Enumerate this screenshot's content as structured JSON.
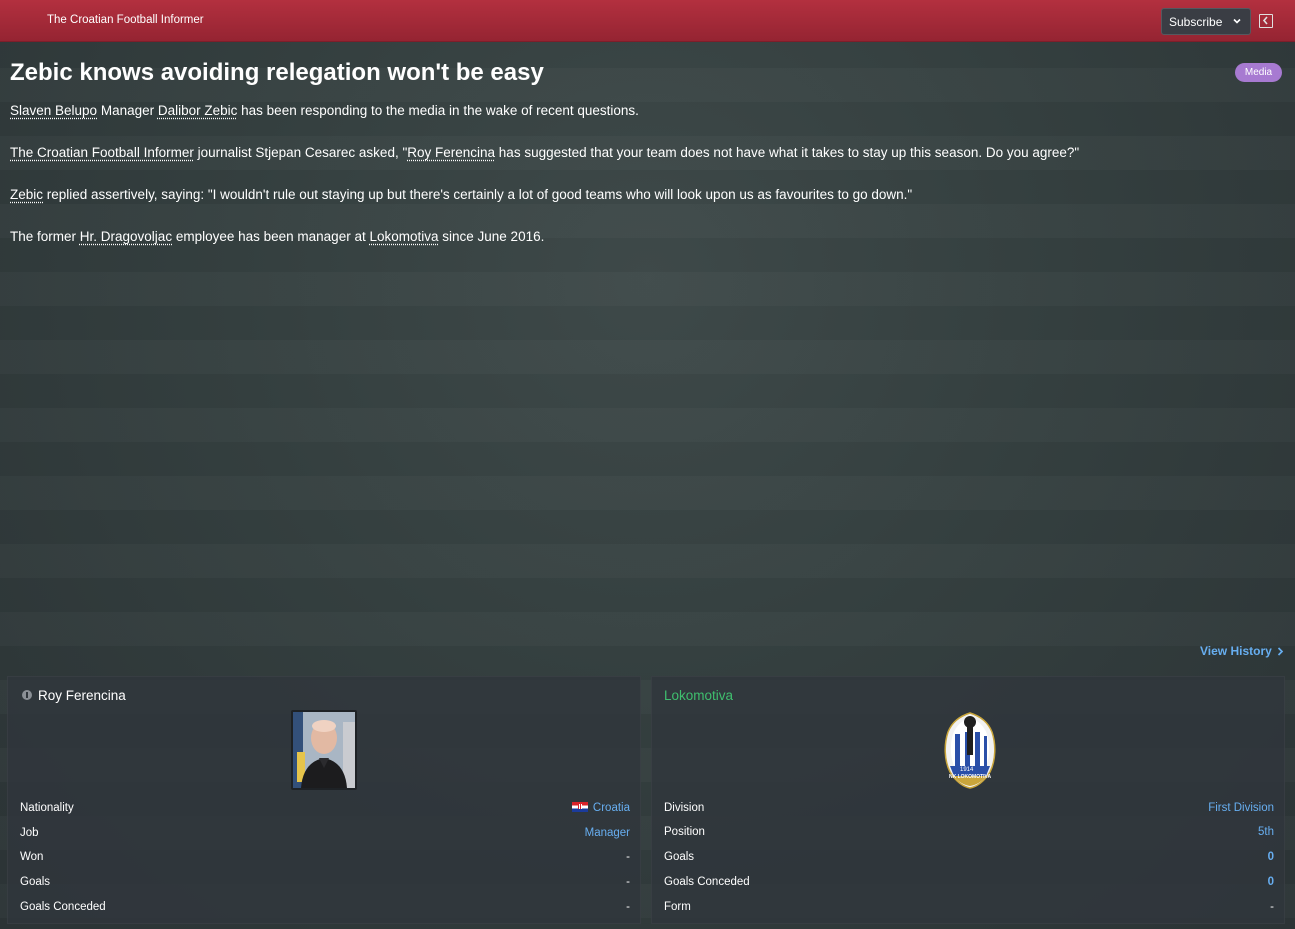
{
  "header": {
    "paper_name": "The Croatian Football Informer",
    "subscribe_label": "Subscribe"
  },
  "article": {
    "headline": "Zebic knows avoiding relegation won't be easy",
    "badge": "Media",
    "p1": {
      "club": "Slaven Belupo",
      "t1": " Manager ",
      "manager": "Dalibor Zebic",
      "t2": " has been responding to the media in the wake of recent questions."
    },
    "p2": {
      "paper": "The Croatian Football Informer",
      "t1": " journalist Stjepan Cesarec asked, \"",
      "person": "Roy Ferencina",
      "t2": " has suggested that your team does not have what it takes to stay up this season. Do you agree?\""
    },
    "p3": {
      "manager": "Zebic",
      "t1": " replied assertively, saying: \"I wouldn't rule out staying up but there's certainly a lot of good teams who will look upon us as favourites to go down.\""
    },
    "p4": {
      "t1": "The former ",
      "club": "Hr. Dragovoljac",
      "t2": " employee has been manager at ",
      "club2": "Lokomotiva",
      "t3": " since June 2016."
    }
  },
  "view_history_label": "View History",
  "person_card": {
    "name": "Roy Ferencina",
    "rows": [
      {
        "label": "Nationality",
        "value": "Croatia"
      },
      {
        "label": "Job",
        "value": "Manager"
      },
      {
        "label": "Won",
        "value": "-"
      },
      {
        "label": "Goals",
        "value": "-"
      },
      {
        "label": "Goals Conceded",
        "value": "-"
      }
    ]
  },
  "club_card": {
    "name": "Lokomotiva",
    "crest_text": "NK LOKOMOTIVA",
    "crest_year": "1914",
    "rows": [
      {
        "label": "Division",
        "value": "First Division"
      },
      {
        "label": "Position",
        "value": "5th"
      },
      {
        "label": "Goals",
        "value": "0"
      },
      {
        "label": "Goals Conceded",
        "value": "0"
      },
      {
        "label": "Form",
        "value": "-"
      }
    ]
  },
  "colors": {
    "topbar": "#a52a39",
    "link_blue": "#67aef0",
    "club_green": "#3fbf6e",
    "badge_purple": "#a77ad1"
  }
}
